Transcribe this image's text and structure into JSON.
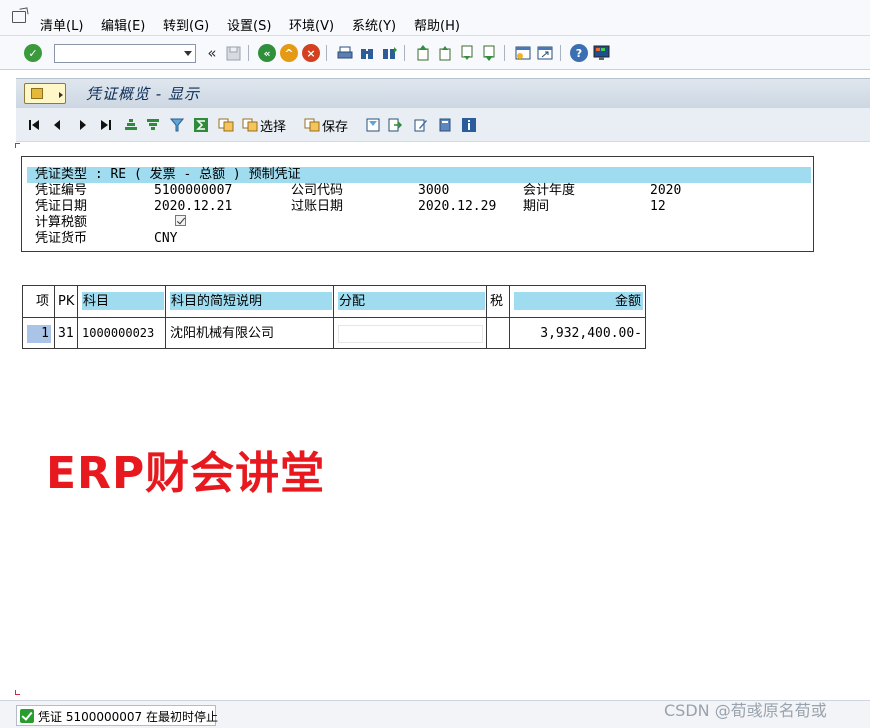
{
  "menu": {
    "items": [
      {
        "label": "清单(L)"
      },
      {
        "label": "编辑(E)"
      },
      {
        "label": "转到(G)"
      },
      {
        "label": "设置(S)"
      },
      {
        "label": "环境(V)"
      },
      {
        "label": "系统(Y)"
      },
      {
        "label": "帮助(H)"
      }
    ]
  },
  "toolbar": {
    "command_value": "",
    "back_glyph": "«"
  },
  "screen": {
    "title": "凭证概览 - 显示"
  },
  "app_toolbar": {
    "select_label": "选择",
    "save_label": "保存"
  },
  "header": {
    "doc_type_line": "凭证类型 : RE ( 发票 - 总额 ) 预制凭证",
    "doc_number_label": "凭证编号",
    "doc_number": "5100000007",
    "company_code_label": "公司代码",
    "company_code": "3000",
    "fiscal_year_label": "会计年度",
    "fiscal_year": "2020",
    "doc_date_label": "凭证日期",
    "doc_date": "2020.12.21",
    "posting_date_label": "过账日期",
    "posting_date": "2020.12.29",
    "period_label": "期间",
    "period": "12",
    "calc_tax_label": "计算税额",
    "calc_tax_checked": true,
    "currency_label": "凭证货币",
    "currency": "CNY"
  },
  "table": {
    "columns": [
      "项",
      "PK",
      "科目",
      "科目的简短说明",
      "分配",
      "税",
      "金额"
    ],
    "rows": [
      {
        "item": "1",
        "pk": "31",
        "account": "1000000023",
        "description": "沈阳机械有限公司",
        "assignment": "",
        "tax": "",
        "amount": "3,932,400.00-"
      }
    ]
  },
  "watermark": "ERP财会讲堂",
  "status": {
    "message": "凭证 5100000007 在最初时停止"
  },
  "credit": "CSDN @荀彧原名荀或"
}
